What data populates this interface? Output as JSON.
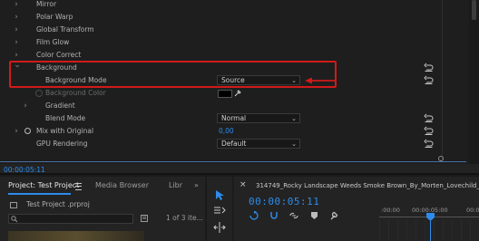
{
  "effects": {
    "rows": [
      {
        "label": "Mirror",
        "arrow": "›"
      },
      {
        "label": "Polar Warp",
        "arrow": "›"
      },
      {
        "label": "Global Transform",
        "arrow": "›"
      },
      {
        "label": "Film Glow",
        "arrow": "›"
      },
      {
        "label": "Color Correct",
        "arrow": "›"
      },
      {
        "label": "Background",
        "arrow": "⌄"
      },
      {
        "label": "Background Mode",
        "value": "Source"
      },
      {
        "label": "Background Color"
      },
      {
        "label": "Gradient",
        "arrow": "›"
      },
      {
        "label": "Blend Mode",
        "value": "Normal"
      },
      {
        "label": "Mix with Original",
        "value": "0,00"
      },
      {
        "label": "GPU Rendering",
        "value": "Default"
      }
    ],
    "timecode": "00:00:05:11"
  },
  "project_panel": {
    "tabs": [
      "Project: Test Project",
      "Media Browser",
      "Libr"
    ],
    "menu_icon": "hamburger-icon",
    "overflow": "»",
    "file_name": "Test Project .prproj",
    "item_count": "1 of 3 ite..."
  },
  "sequence_panel": {
    "title": "314749_Rocky Landscape Weeds Smoke Brown_By_Morten_Lovechild_Artli",
    "timecode": "00:00:05:11",
    "ruler": [
      ":00:00",
      "00:00:05:00",
      "00:0"
    ]
  },
  "colors": {
    "accent_blue": "#2d8ceb",
    "highlight_red": "#d11a1a"
  }
}
